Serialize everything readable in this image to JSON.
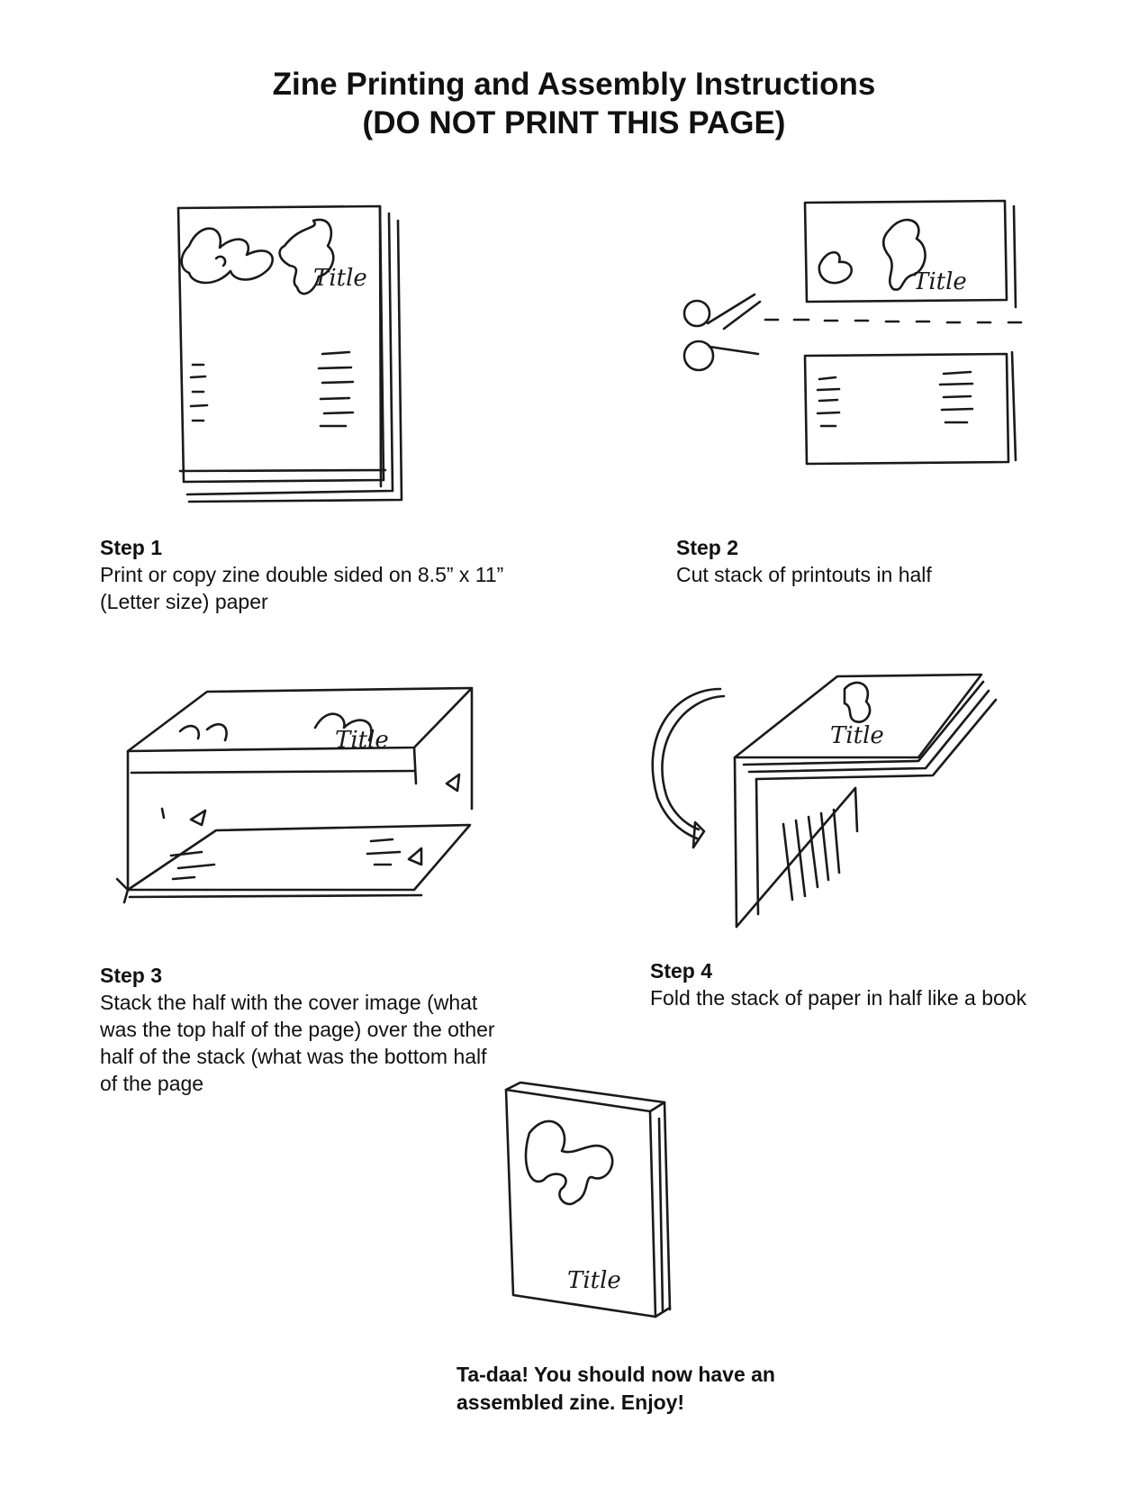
{
  "page": {
    "title_line1": "Zine Printing and Assembly Instructions",
    "title_line2": "(DO NOT PRINT THIS PAGE)"
  },
  "steps": [
    {
      "label": "Step 1",
      "text_line1": "Print or copy zine double sided on 8.5” x 11”",
      "text_line2": "(Letter size) paper"
    },
    {
      "label": "Step 2",
      "text_line1": "Cut stack of printouts in half"
    },
    {
      "label": "Step 3",
      "text_line1": "Stack the half with the cover image (what",
      "text_line2": "was the top half of the page) over the other",
      "text_line3": "half of the stack (what was the bottom half",
      "text_line4": "of the page"
    },
    {
      "label": "Step 4",
      "text_line1": "Fold the stack of paper in half like a book"
    }
  ],
  "final": {
    "line1": "Ta-daa!  You should now have an",
    "line2": "assembled zine. Enjoy!"
  },
  "sketch_labels": {
    "title_word": "Title"
  },
  "icons": {
    "scissors": "scissors-icon",
    "arrow": "curved-arrow-icon"
  }
}
